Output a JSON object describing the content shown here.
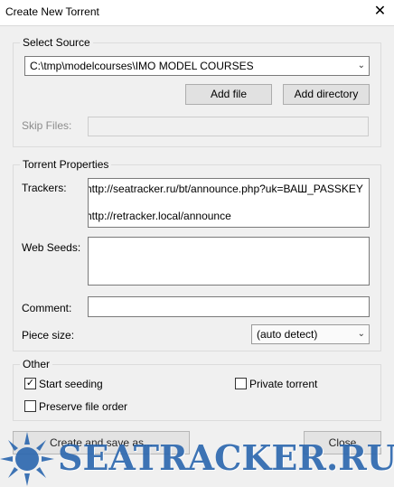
{
  "window": {
    "title": "Create New Torrent",
    "close_glyph": "✕"
  },
  "source": {
    "legend": "Select Source",
    "path": "C:\\tmp\\modelcourses\\IMO MODEL COURSES",
    "add_file": "Add file",
    "add_directory": "Add directory",
    "skip_files_label": "Skip Files:"
  },
  "properties": {
    "legend": "Torrent Properties",
    "trackers_label": "Trackers:",
    "trackers": [
      "http://seatracker.ru/bt/announce.php?uk=ВАШ_PASSKEY",
      "http://retracker.local/announce"
    ],
    "web_seeds_label": "Web Seeds:",
    "comment_label": "Comment:",
    "comment_value": "",
    "piece_size_label": "Piece size:",
    "piece_size_value": "(auto detect)"
  },
  "other": {
    "legend": "Other",
    "start_seeding": {
      "label": "Start seeding",
      "checked": true
    },
    "private_torrent": {
      "label": "Private torrent",
      "checked": false
    },
    "preserve_order": {
      "label": "Preserve file order",
      "checked": false
    }
  },
  "actions": {
    "create_save": "Create and save as...",
    "close": "Close"
  },
  "watermark": {
    "text": "SEATRACKER.RU",
    "color": "#2a66ae"
  }
}
